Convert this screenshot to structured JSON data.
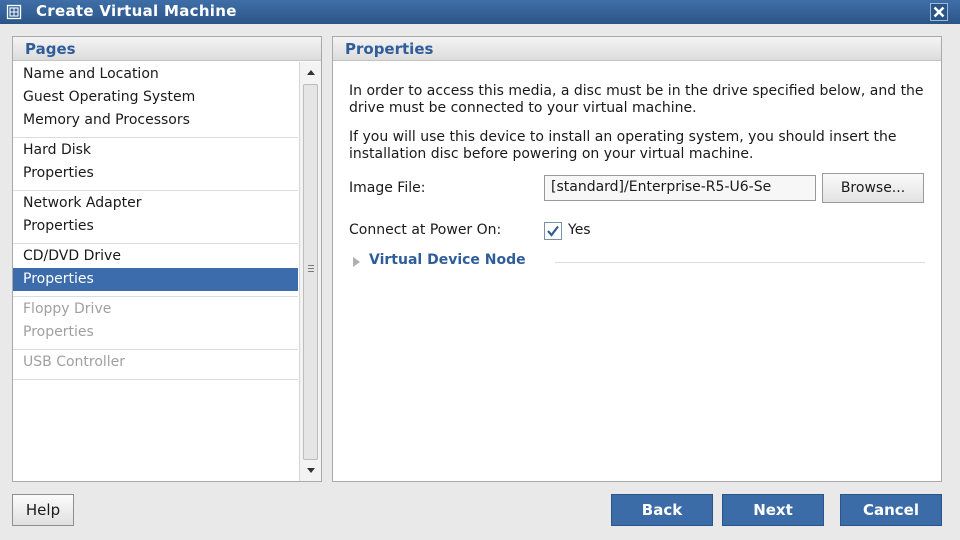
{
  "window": {
    "title": "Create Virtual Machine",
    "app_icon": "vm-icon",
    "close_icon": "close-icon"
  },
  "pages": {
    "header": "Pages",
    "groups": [
      {
        "items": [
          {
            "label": "Name and Location"
          },
          {
            "label": "Guest Operating System"
          },
          {
            "label": "Memory and Processors"
          }
        ]
      },
      {
        "items": [
          {
            "label": "Hard Disk"
          },
          {
            "label": "Properties"
          }
        ]
      },
      {
        "items": [
          {
            "label": "Network Adapter"
          },
          {
            "label": "Properties"
          }
        ]
      },
      {
        "items": [
          {
            "label": "CD/DVD Drive"
          },
          {
            "label": "Properties",
            "selected": true
          }
        ]
      },
      {
        "disabled": true,
        "items": [
          {
            "label": "Floppy Drive"
          },
          {
            "label": "Properties"
          }
        ]
      },
      {
        "disabled": true,
        "items": [
          {
            "label": "USB Controller"
          }
        ]
      }
    ]
  },
  "properties": {
    "header": "Properties",
    "para1": "In order to access this media, a disc must be in the drive specified below, and the drive must be connected to your virtual machine.",
    "para2": "If you will use this device to install an operating system, you should insert the installation disc before powering on your virtual machine.",
    "image_file": {
      "label": "Image File:",
      "value": "[standard]/Enterprise-R5-U6-Se",
      "browse_label": "Browse..."
    },
    "connect": {
      "label": "Connect at Power On:",
      "checked": true,
      "check_label": "Yes"
    },
    "virtual_device_node": "Virtual Device Node"
  },
  "buttons": {
    "help": "Help",
    "back": "Back",
    "next": "Next",
    "cancel": "Cancel"
  },
  "colors": {
    "title_bar": "#2f5f97",
    "accent": "#2f5d9a",
    "selection": "#3c6cab",
    "button_blue": "#3b6ca8"
  }
}
